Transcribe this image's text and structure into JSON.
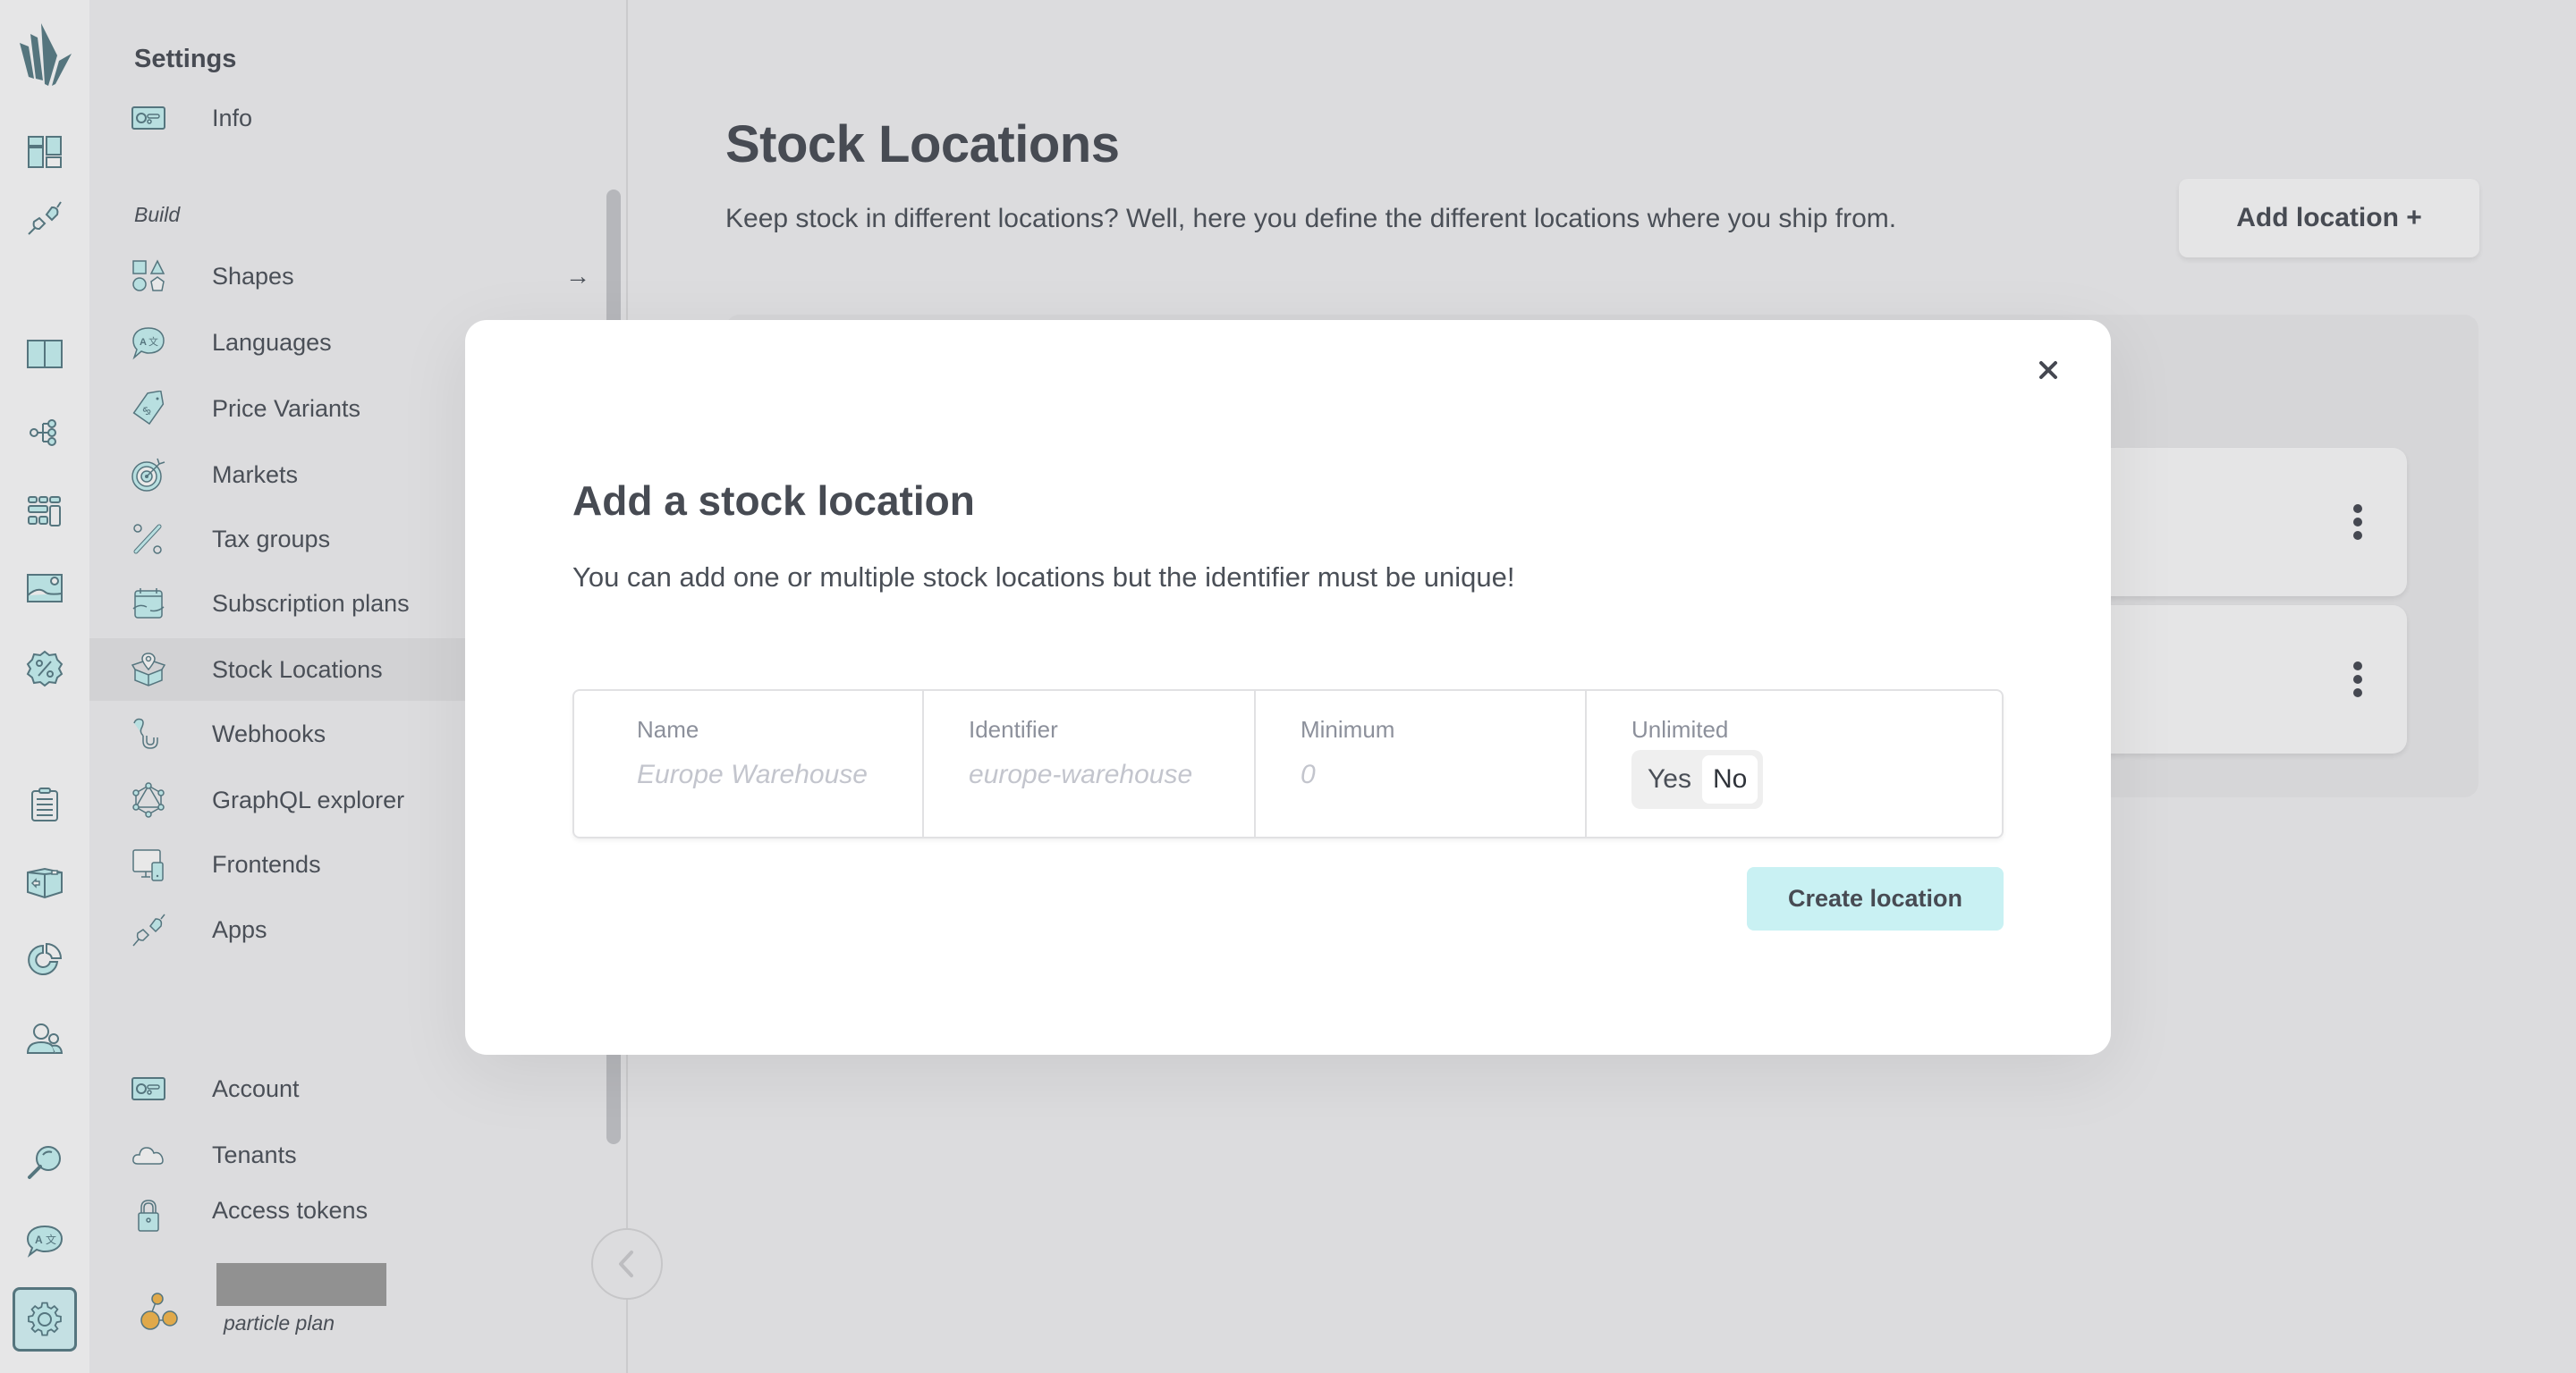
{
  "rail": {
    "items": [
      {
        "icon": "dashboard-icon"
      },
      {
        "icon": "plug-icon"
      },
      {
        "icon": "catalogue-book-icon"
      },
      {
        "icon": "tree-icon"
      },
      {
        "icon": "grid-icon"
      },
      {
        "icon": "image-icon"
      },
      {
        "icon": "discount-badge-icon"
      },
      {
        "icon": "clipboard-icon"
      },
      {
        "icon": "box-icon"
      },
      {
        "icon": "pie-chart-icon"
      },
      {
        "icon": "users-icon"
      },
      {
        "icon": "search-icon"
      },
      {
        "icon": "translate-icon"
      },
      {
        "icon": "gear-icon",
        "active": true
      }
    ]
  },
  "sidebar": {
    "title": "Settings",
    "top_items": [
      {
        "label": "Info",
        "icon": "id-card-icon"
      }
    ],
    "build_label": "Build",
    "build_items": [
      {
        "label": "Shapes",
        "icon": "shapes-icon",
        "arrow": "→"
      },
      {
        "label": "Languages",
        "icon": "translate-icon"
      },
      {
        "label": "Price Variants",
        "icon": "price-tag-icon"
      },
      {
        "label": "Markets",
        "icon": "target-icon"
      },
      {
        "label": "Tax groups",
        "icon": "percent-icon"
      },
      {
        "label": "Subscription plans",
        "icon": "calendar-repeat-icon"
      },
      {
        "label": "Stock Locations",
        "icon": "box-location-icon",
        "active": true
      },
      {
        "label": "Webhooks",
        "icon": "hook-icon"
      },
      {
        "label": "GraphQL explorer",
        "icon": "graphql-icon"
      },
      {
        "label": "Frontends",
        "icon": "devices-icon"
      },
      {
        "label": "Apps",
        "icon": "plug-icon"
      }
    ],
    "account_items": [
      {
        "label": "Account",
        "icon": "id-card-icon"
      },
      {
        "label": "Tenants",
        "icon": "cloud-icon"
      },
      {
        "label": "Access tokens",
        "icon": "lock-icon"
      }
    ],
    "tenant": {
      "plan": "particle plan"
    }
  },
  "main": {
    "title": "Stock Locations",
    "description": "Keep stock in different locations? Well, here you define the different locations where you ship from.",
    "add_button": "Add location +",
    "rows": [
      {},
      {}
    ]
  },
  "modal": {
    "title": "Add a stock location",
    "description": "You can add one or multiple stock locations but the identifier must be unique!",
    "fields": {
      "name": {
        "label": "Name",
        "placeholder": "Europe Warehouse",
        "value": ""
      },
      "identifier": {
        "label": "Identifier",
        "placeholder": "europe-warehouse",
        "value": ""
      },
      "minimum": {
        "label": "Minimum",
        "placeholder": "0",
        "value": ""
      },
      "unlimited": {
        "label": "Unlimited",
        "options": [
          "Yes",
          "No"
        ],
        "selected": "No"
      }
    },
    "submit_label": "Create location",
    "close_icon": "close-icon"
  },
  "colors": {
    "accent_light": "#c9f1f3",
    "icon_stroke": "#55757e",
    "icon_fill": "#b8dfe0",
    "text": "#4a4f57",
    "tenant_icon": "#e0a94a"
  }
}
